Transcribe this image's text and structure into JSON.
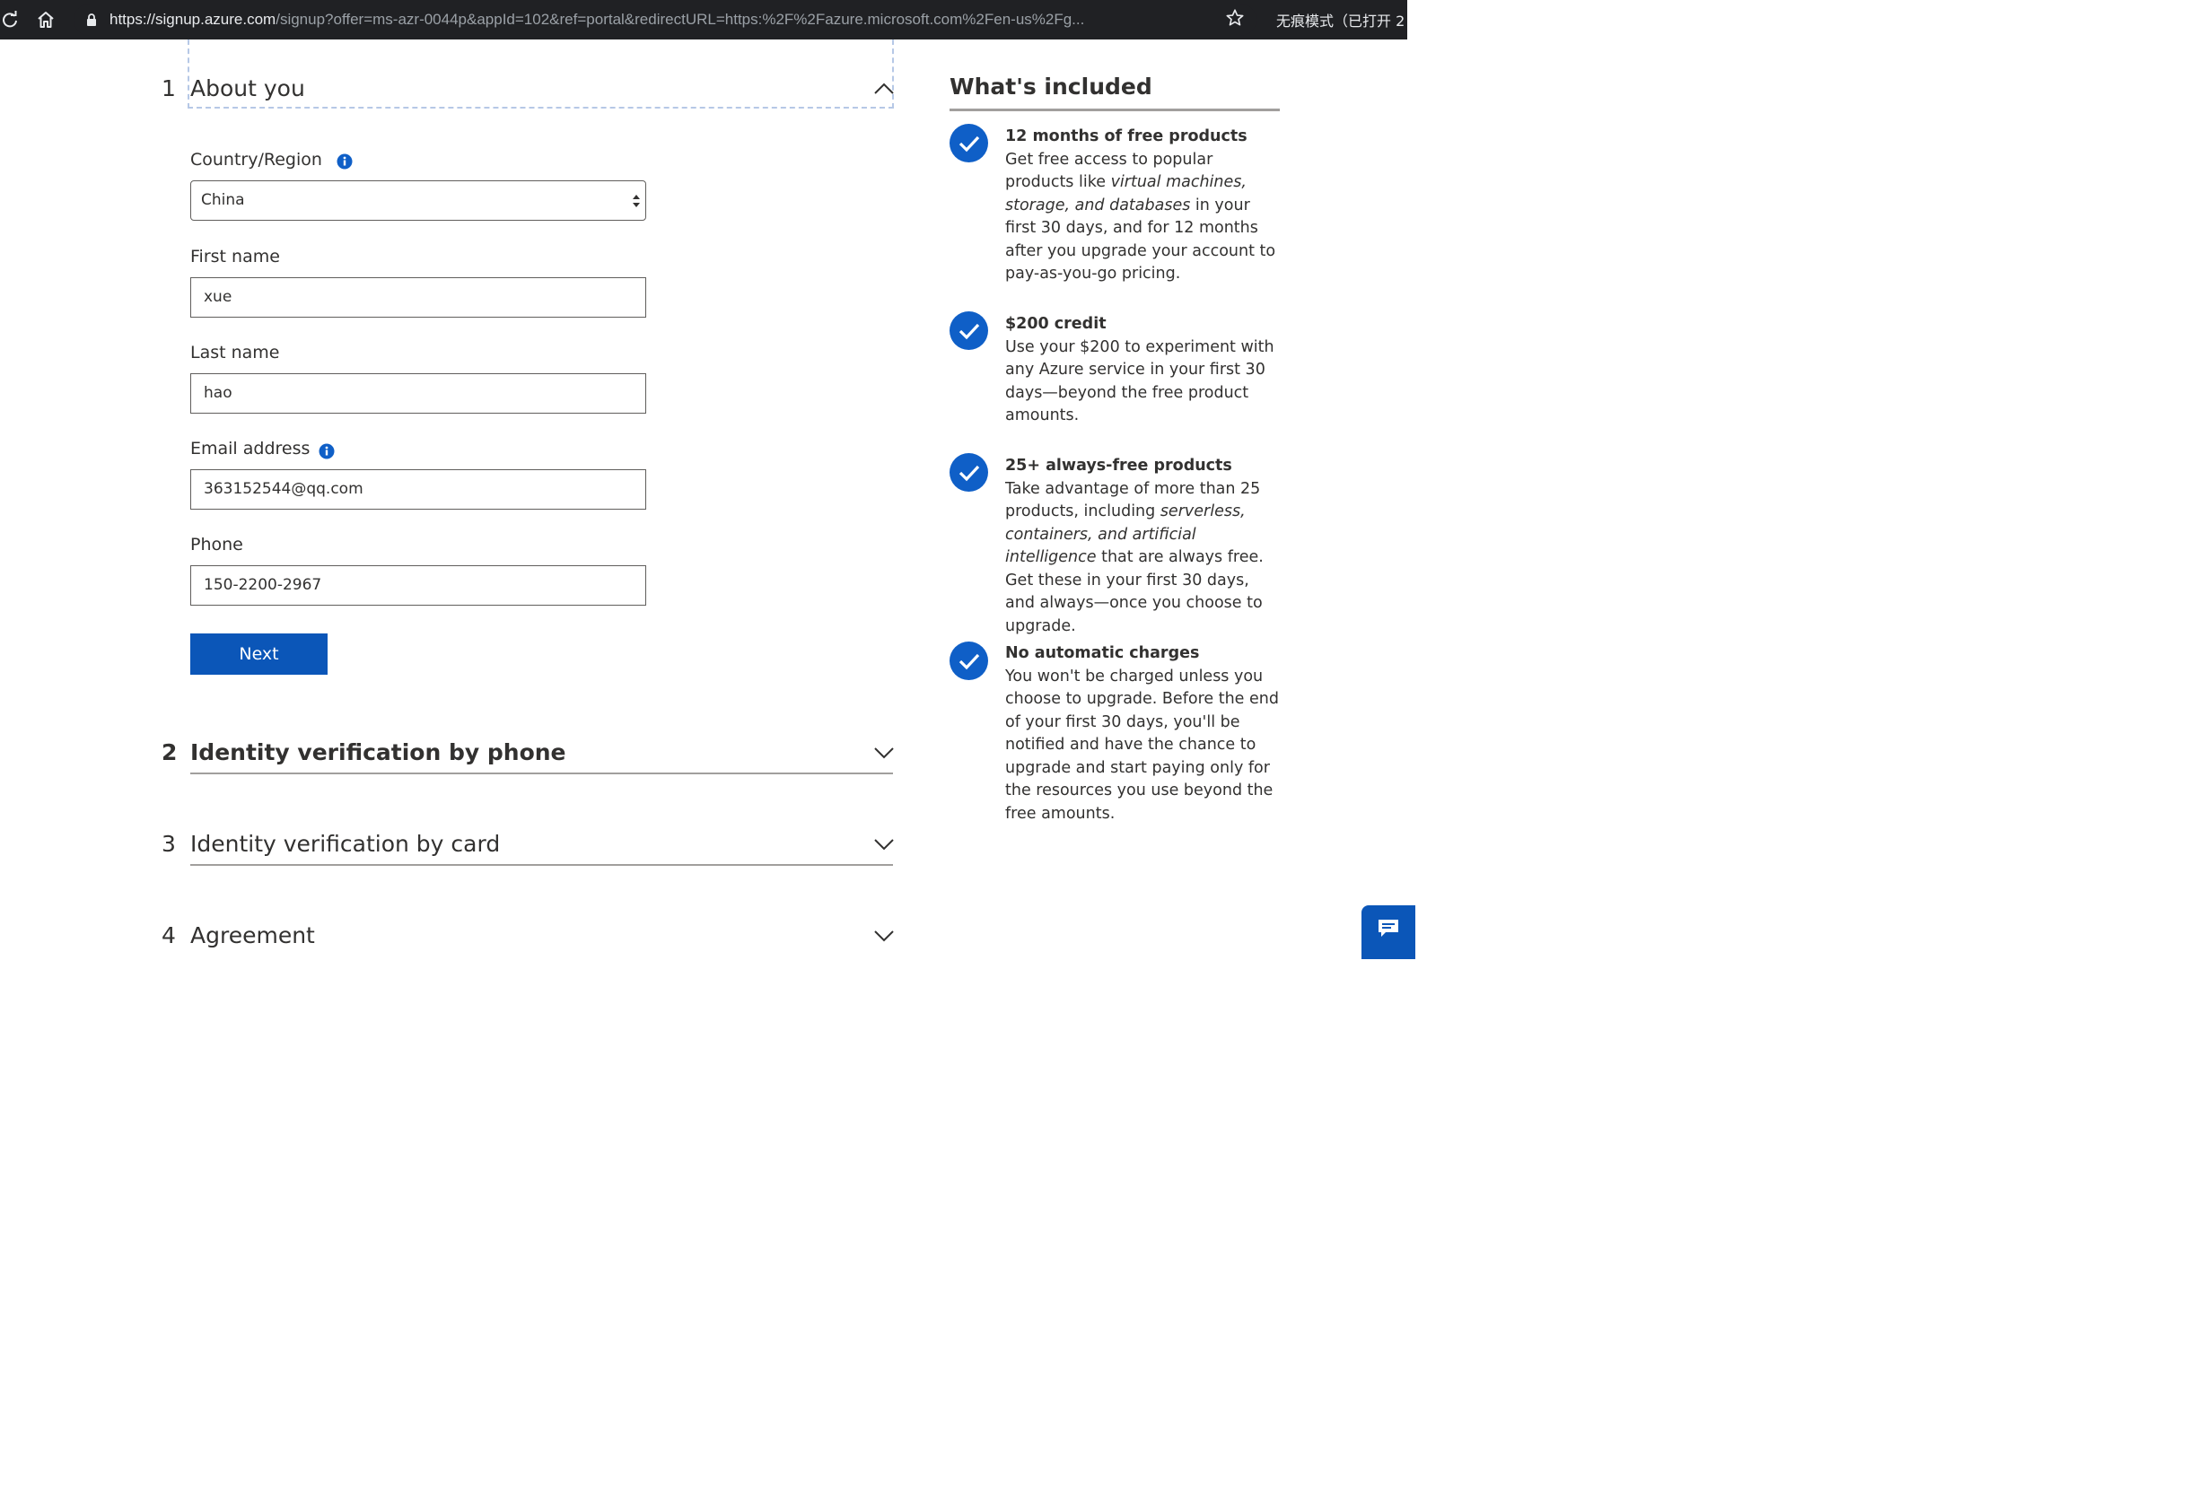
{
  "browser": {
    "url_host": "https://signup.azure.com",
    "url_path": "/signup?offer=ms-azr-0044p&appId=102&ref=portal&redirectURL=https:%2F%2Fazure.microsoft.com%2Fen-us%2Fg...",
    "incognito_label": "无痕模式（已打开 2"
  },
  "steps": [
    {
      "number": "1",
      "title": "About you"
    },
    {
      "number": "2",
      "title": "Identity verification by phone"
    },
    {
      "number": "3",
      "title": "Identity verification by card"
    },
    {
      "number": "4",
      "title": "Agreement"
    }
  ],
  "form": {
    "country_label": "Country/Region",
    "country_value": "China",
    "first_name_label": "First name",
    "first_name_value": "xue",
    "last_name_label": "Last name",
    "last_name_value": "hao",
    "email_label": "Email address",
    "email_value": "363152544@qq.com",
    "phone_label": "Phone",
    "phone_value": "150-2200-2967",
    "next_label": "Next"
  },
  "included": {
    "title": "What's included",
    "items": [
      {
        "title": "12 months of free products",
        "text_before": "Get free access to popular products like ",
        "text_em": "virtual machines, storage, and databases",
        "text_after": " in your first 30 days, and for 12 months after you upgrade your account to pay-as-you-go pricing."
      },
      {
        "title": "$200 credit",
        "text_before": "Use your $200 to experiment with any Azure service in your first 30 days—beyond the free product amounts.",
        "text_em": "",
        "text_after": ""
      },
      {
        "title": "25+ always-free products",
        "text_before": "Take advantage of more than 25 products, including ",
        "text_em": "serverless, containers, and artificial intelligence",
        "text_after": " that are always free. Get these in your first 30 days, and always—once you choose to upgrade."
      },
      {
        "title": "No automatic charges",
        "text_before": "You won't be charged unless you choose to upgrade. Before the end of your first 30 days, you'll be notified and have the chance to upgrade and start paying only for the resources you use beyond the free amounts.",
        "text_em": "",
        "text_after": ""
      }
    ]
  },
  "colors": {
    "accent": "#0b56b8",
    "check": "#0f5fc7",
    "browser_bar": "#202124"
  }
}
